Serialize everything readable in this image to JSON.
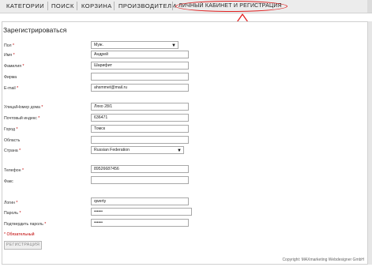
{
  "nav": {
    "items": [
      "КАТЕГОРИИ",
      "ПОИСК",
      "КОРЗИНА",
      "ПРОИЗВОДИТЕЛИ",
      "ЛИЧНЫЙ КАБИНЕТ И РЕГИСТРАЦИЯ"
    ]
  },
  "page": {
    "title": "Зарегистрироваться"
  },
  "form": {
    "gender": {
      "label": "Пол",
      "value": "Муж."
    },
    "first_name": {
      "label": "Имя",
      "value": "Андрей"
    },
    "last_name": {
      "label": "Фамилия",
      "value": "Шарифит"
    },
    "company": {
      "label": "Фирма",
      "value": ""
    },
    "email": {
      "label": "E-mail",
      "value": "ahsmmet@mail.ru"
    },
    "street": {
      "label": "Улица/Номер дома",
      "value": "Ляхо 28/1"
    },
    "postcode": {
      "label": "Почтовый индекс",
      "value": "636471"
    },
    "city": {
      "label": "Город",
      "value": "Томск"
    },
    "region": {
      "label": "Область",
      "value": ""
    },
    "country": {
      "label": "Страна",
      "value": "Russian Federation"
    },
    "phone": {
      "label": "Телефон",
      "value": "89526687456"
    },
    "fax": {
      "label": "Факс",
      "value": ""
    },
    "login": {
      "label": "Логин",
      "value": "qwerty"
    },
    "password": {
      "label": "Пароль",
      "value": "••••••"
    },
    "password_confirm": {
      "label": "Подтвердить пароль",
      "value": "••••••"
    },
    "required_mark": "*",
    "required_note": "* Обязательный",
    "submit_label": "РЕГИСТРАЦИЯ"
  },
  "footer": {
    "copyright": "Copyright: MAXmarketing Webdesigner GmbH"
  },
  "colors": {
    "annotation": "#e02020",
    "required": "#c00000"
  }
}
